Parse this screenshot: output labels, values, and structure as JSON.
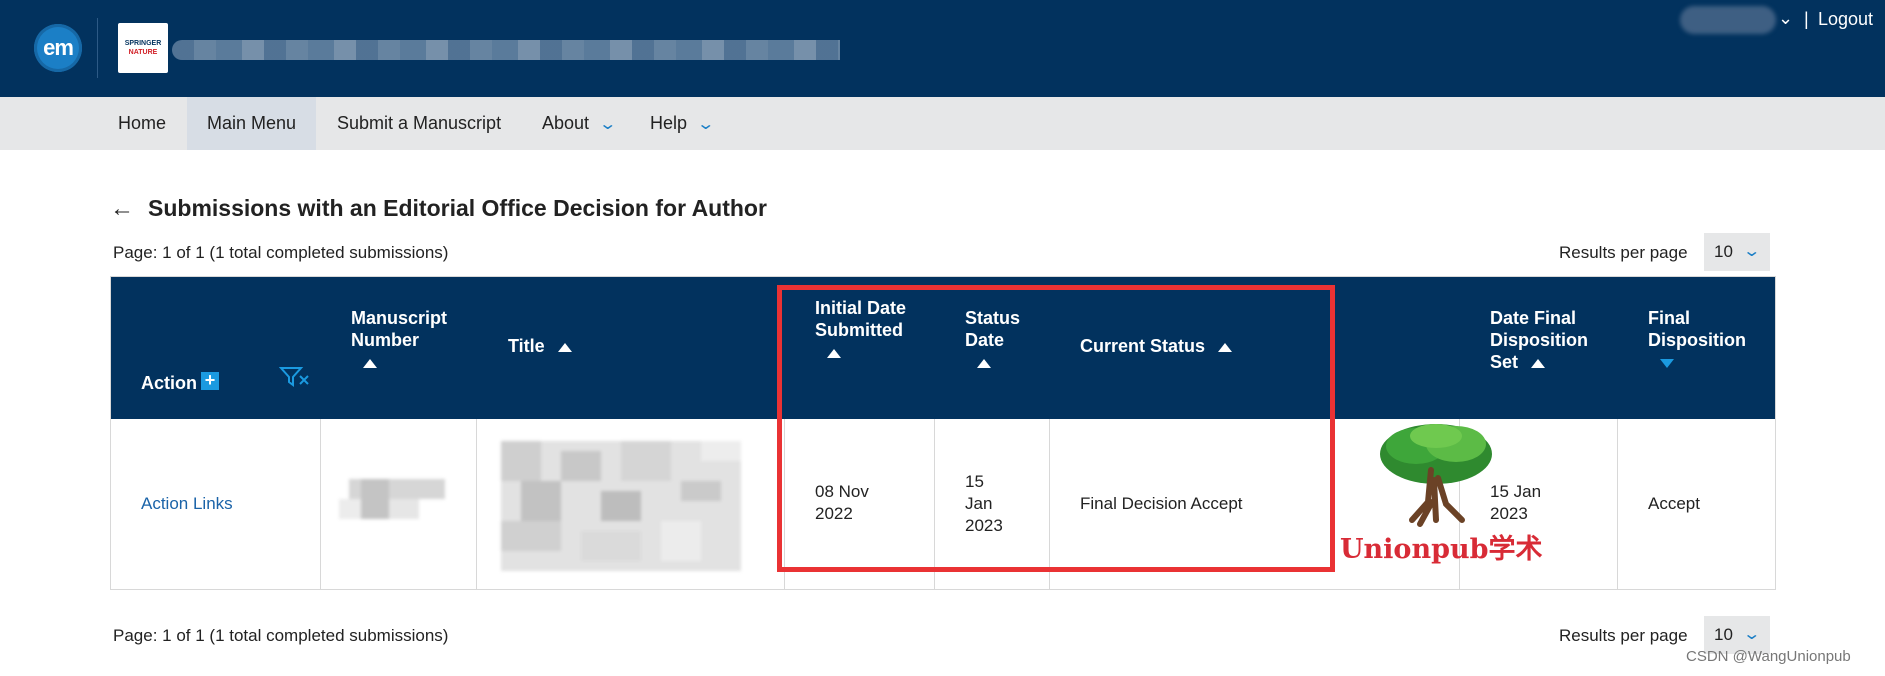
{
  "header": {
    "em_logo": "em",
    "publisher_logo": {
      "line1": "SPRINGER",
      "line2": "NATURE"
    },
    "separator": "|",
    "logout_label": "Logout"
  },
  "nav": {
    "items": [
      {
        "label": "Home"
      },
      {
        "label": "Main Menu"
      },
      {
        "label": "Submit a Manuscript"
      },
      {
        "label": "About",
        "has_dropdown": true
      },
      {
        "label": "Help",
        "has_dropdown": true
      }
    ],
    "active_index": 1
  },
  "page": {
    "title": "Submissions with an Editorial Office Decision for Author",
    "pager_top": "Page: 1 of 1 (1 total completed submissions)",
    "pager_bottom": "Page: 1 of 1 (1 total completed submissions)",
    "results_per_page_label": "Results per page",
    "results_per_page_value": "10"
  },
  "table": {
    "columns": [
      {
        "key": "action",
        "label": "Action"
      },
      {
        "key": "manuscript_number",
        "label": "Manuscript Number"
      },
      {
        "key": "title",
        "label": "Title"
      },
      {
        "key": "initial_date_submitted",
        "label": "Initial Date Submitted"
      },
      {
        "key": "status_date",
        "label": "Status Date"
      },
      {
        "key": "current_status",
        "label": "Current Status"
      },
      {
        "key": "date_final_disposition_set",
        "label": "Date Final Disposition Set"
      },
      {
        "key": "final_disposition",
        "label": "Final Disposition"
      }
    ],
    "rows": [
      {
        "action": "Action Links",
        "initial_date_submitted": "08 Nov 2022",
        "status_date": "15 Jan 2023",
        "current_status": "Final Decision Accept",
        "date_final_disposition_set": "15 Jan 2023",
        "final_disposition": "Accept"
      }
    ]
  },
  "watermark": {
    "text": "Unionpub学术",
    "credit": "CSDN @WangUnionpub"
  },
  "colors": {
    "header_bg": "#02325e",
    "nav_bg": "#e6e7e8",
    "accent_blue": "#1b9ae0",
    "link_blue": "#1a63a8",
    "highlight_red": "#ea3234"
  }
}
